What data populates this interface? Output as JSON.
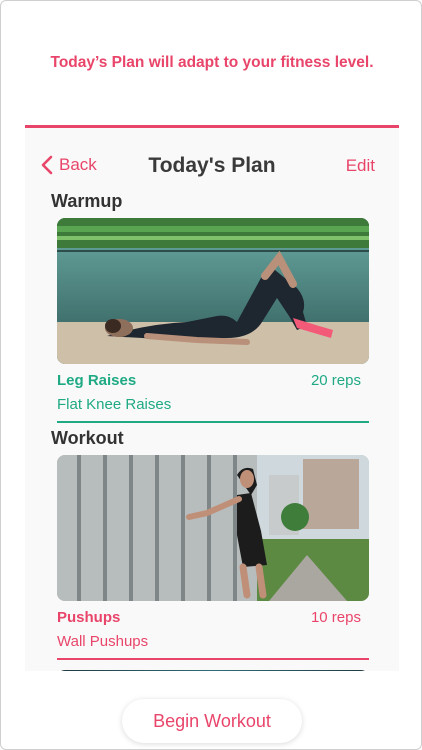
{
  "promo": {
    "text": "Today’s Plan will adapt to your fitness level."
  },
  "nav": {
    "back_label": "Back",
    "title": "Today's Plan",
    "edit_label": "Edit"
  },
  "sections": [
    {
      "title": "Warmup",
      "exercise": {
        "name": "Leg Raises",
        "reps": "20 reps",
        "variant": "Flat Knee Raises",
        "accent": "#1faa84"
      }
    },
    {
      "title": "Workout",
      "exercise": {
        "name": "Pushups",
        "reps": "10 reps",
        "variant": "Wall Pushups",
        "accent": "#e9456a"
      }
    }
  ],
  "footer": {
    "begin_label": "Begin Workout"
  },
  "colors": {
    "accent_red": "#e9456a",
    "accent_green": "#1faa84"
  }
}
